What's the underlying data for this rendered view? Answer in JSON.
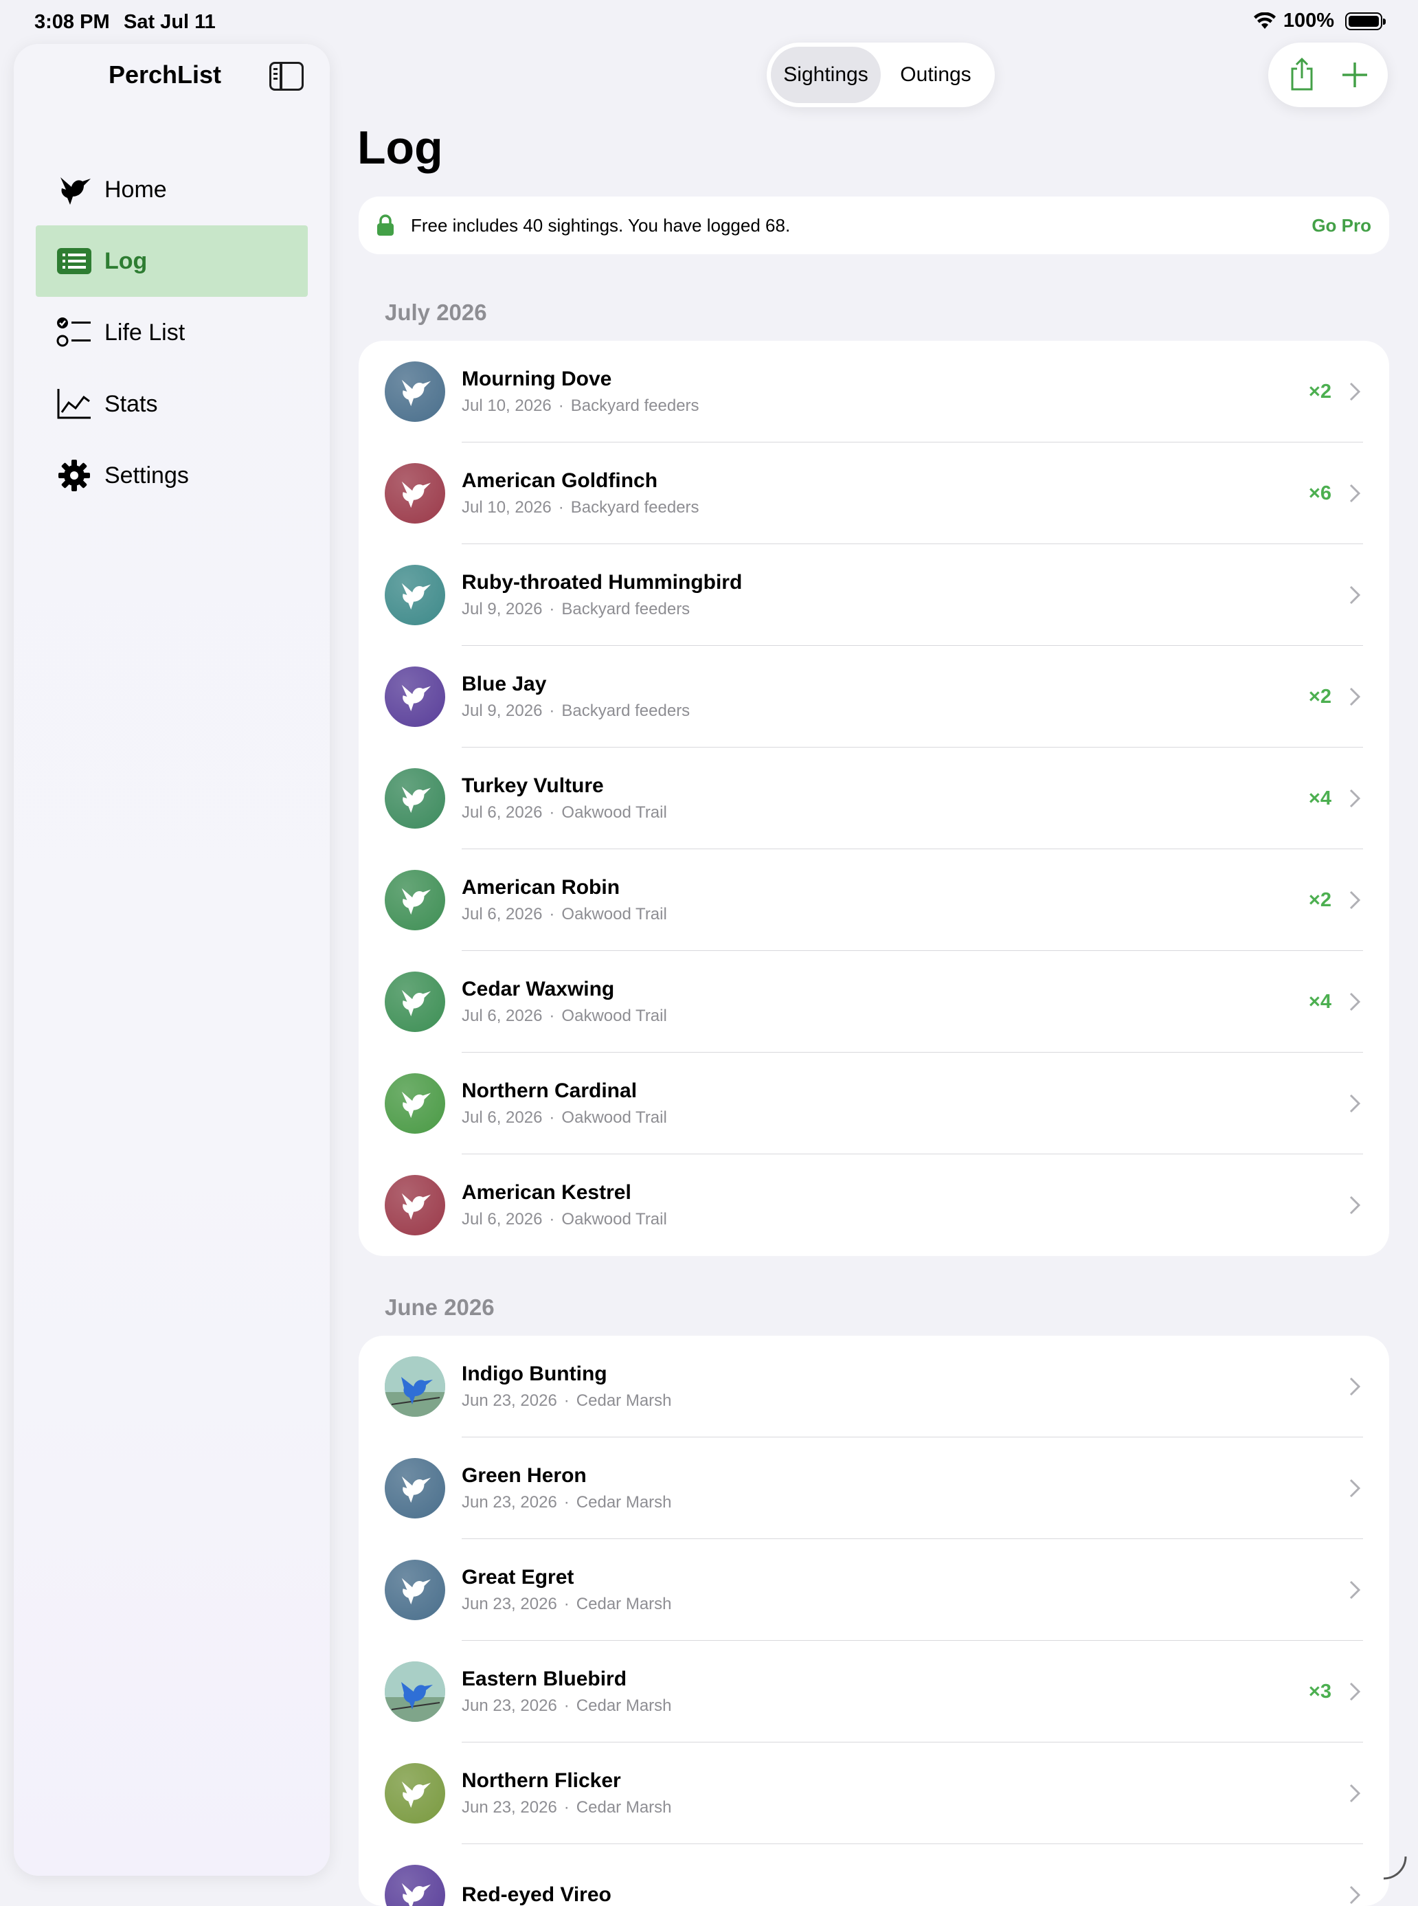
{
  "status": {
    "time": "3:08 PM",
    "date": "Sat Jul 11",
    "battery": "100%"
  },
  "sidebar": {
    "title": "PerchList",
    "items": [
      {
        "label": "Home",
        "icon": "hummingbird-icon"
      },
      {
        "label": "Log",
        "icon": "list-icon",
        "active": true
      },
      {
        "label": "Life List",
        "icon": "checklist-icon"
      },
      {
        "label": "Stats",
        "icon": "chart-icon"
      },
      {
        "label": "Settings",
        "icon": "gear-icon"
      }
    ]
  },
  "segments": {
    "sightings": "Sightings",
    "outings": "Outings"
  },
  "page_title": "Log",
  "banner": {
    "message": "Free includes 40 sightings. You have logged 68.",
    "action": "Go Pro"
  },
  "colors": {
    "accent": "#43a047",
    "active_bg": "#c8e6c9"
  },
  "sections": [
    {
      "header": "July 2026",
      "rows": [
        {
          "name": "Mourning Dove",
          "date": "Jul 10, 2026",
          "place": "Backyard feeders",
          "count": "×2",
          "color": "#4a6f8c"
        },
        {
          "name": "American Goldfinch",
          "date": "Jul 10, 2026",
          "place": "Backyard feeders",
          "count": "×6",
          "color": "#9b3a4a"
        },
        {
          "name": "Ruby-throated Hummingbird",
          "date": "Jul 9, 2026",
          "place": "Backyard feeders",
          "count": "",
          "color": "#3e8a8a"
        },
        {
          "name": "Blue Jay",
          "date": "Jul 9, 2026",
          "place": "Backyard feeders",
          "count": "×2",
          "color": "#5a3f9a"
        },
        {
          "name": "Turkey Vulture",
          "date": "Jul 6, 2026",
          "place": "Oakwood Trail",
          "count": "×4",
          "color": "#3d8b5e"
        },
        {
          "name": "American Robin",
          "date": "Jul 6, 2026",
          "place": "Oakwood Trail",
          "count": "×2",
          "color": "#3f8f55"
        },
        {
          "name": "Cedar Waxwing",
          "date": "Jul 6, 2026",
          "place": "Oakwood Trail",
          "count": "×4",
          "color": "#3d8f55"
        },
        {
          "name": "Northern Cardinal",
          "date": "Jul 6, 2026",
          "place": "Oakwood Trail",
          "count": "",
          "color": "#4a9a45"
        },
        {
          "name": "American Kestrel",
          "date": "Jul 6, 2026",
          "place": "Oakwood Trail",
          "count": "",
          "color": "#9b3a4a"
        }
      ]
    },
    {
      "header": "June 2026",
      "rows": [
        {
          "name": "Indigo Bunting",
          "date": "Jun 23, 2026",
          "place": "Cedar Marsh",
          "count": "",
          "color": "#8fb8b0",
          "photo": true
        },
        {
          "name": "Green Heron",
          "date": "Jun 23, 2026",
          "place": "Cedar Marsh",
          "count": "",
          "color": "#4a6f8c"
        },
        {
          "name": "Great Egret",
          "date": "Jun 23, 2026",
          "place": "Cedar Marsh",
          "count": "",
          "color": "#4a6f8c"
        },
        {
          "name": "Eastern Bluebird",
          "date": "Jun 23, 2026",
          "place": "Cedar Marsh",
          "count": "×3",
          "color": "#8fb8b0",
          "photo": true
        },
        {
          "name": "Northern Flicker",
          "date": "Jun 23, 2026",
          "place": "Cedar Marsh",
          "count": "",
          "color": "#7a9a40"
        },
        {
          "name": "Red-eyed Vireo",
          "date": "",
          "place": "",
          "count": "",
          "color": "#5a3f9a"
        }
      ]
    }
  ]
}
